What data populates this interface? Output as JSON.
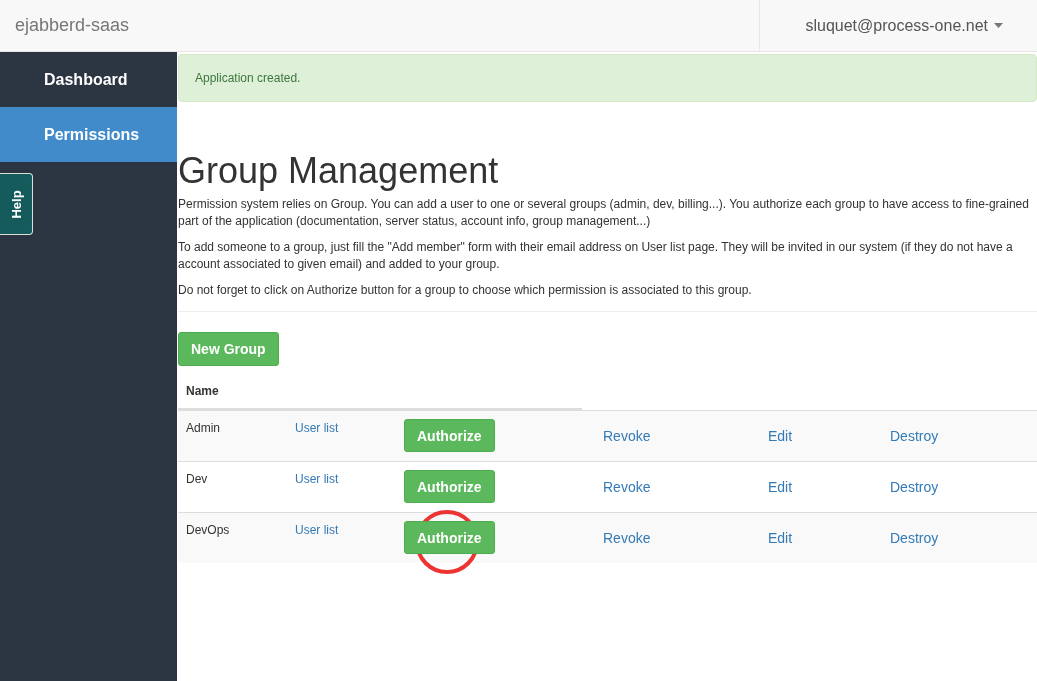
{
  "navbar": {
    "brand": "ejabberd-saas",
    "user_menu": "sluquet@process-one.net"
  },
  "sidebar": {
    "items": [
      {
        "label": "Dashboard",
        "selected": false
      },
      {
        "label": "Permissions",
        "selected": true
      }
    ],
    "help_tab": "Help"
  },
  "alert": "Application created.",
  "heading": "Group Management",
  "paragraphs": [
    "Permission system relies on Group. You can add a user to one or several groups (admin, dev, billing...). You authorize each group to have access to fine-grained part of the application (documentation, server status, account info, group management...)",
    "To add someone to a group, just fill the \"Add member\" form with their email address on User list page. They will be invited in our system (if they do not have a account associated to given email) and added to your group.",
    "Do not forget to click on Authorize button for a group to choose which permission is associated to this group."
  ],
  "new_group_button": "New Group",
  "table": {
    "columns": [
      "Name"
    ],
    "rows": [
      {
        "name": "Admin",
        "user_list": "User list",
        "authorize": "Authorize",
        "revoke": "Revoke",
        "edit": "Edit",
        "destroy": "Destroy",
        "highlighted": false
      },
      {
        "name": "Dev",
        "user_list": "User list",
        "authorize": "Authorize",
        "revoke": "Revoke",
        "edit": "Edit",
        "destroy": "Destroy",
        "highlighted": false
      },
      {
        "name": "DevOps",
        "user_list": "User list",
        "authorize": "Authorize",
        "revoke": "Revoke",
        "edit": "Edit",
        "destroy": "Destroy",
        "highlighted": true
      }
    ]
  }
}
